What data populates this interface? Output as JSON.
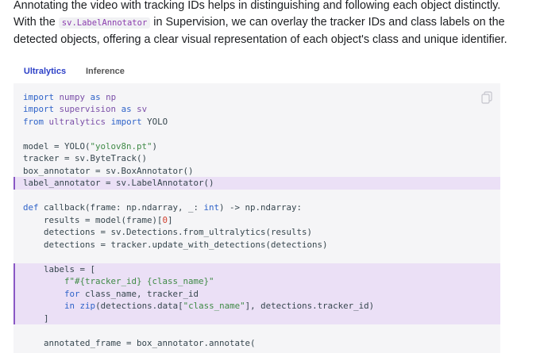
{
  "prose": {
    "line1": "Annotating the video with tracking IDs helps in distinguishing and following each object distinctly.",
    "line2_before": "With the ",
    "inline_code": "sv.LabelAnnotator",
    "line2_after": " in Supervision, we can overlay the tracker IDs and class labels on the",
    "line3": "detected objects, offering a clear visual representation of each object's class and unique identifier."
  },
  "tabs": [
    {
      "label": "Ultralytics",
      "active": true
    },
    {
      "label": "Inference",
      "active": false
    }
  ],
  "code": {
    "copy_icon": "copy-icon",
    "lines": [
      {
        "tokens": [
          [
            "kw",
            "import"
          ],
          [
            "plain",
            " "
          ],
          [
            "mod",
            "numpy"
          ],
          [
            "plain",
            " "
          ],
          [
            "kw",
            "as"
          ],
          [
            "plain",
            " "
          ],
          [
            "mod",
            "np"
          ]
        ]
      },
      {
        "tokens": [
          [
            "kw",
            "import"
          ],
          [
            "plain",
            " "
          ],
          [
            "mod",
            "supervision"
          ],
          [
            "plain",
            " "
          ],
          [
            "kw",
            "as"
          ],
          [
            "plain",
            " "
          ],
          [
            "mod",
            "sv"
          ]
        ]
      },
      {
        "tokens": [
          [
            "kw",
            "from"
          ],
          [
            "plain",
            " "
          ],
          [
            "mod",
            "ultralytics"
          ],
          [
            "plain",
            " "
          ],
          [
            "kw",
            "import"
          ],
          [
            "plain",
            " YOLO"
          ]
        ]
      },
      {
        "tokens": []
      },
      {
        "tokens": [
          [
            "plain",
            "model = YOLO("
          ],
          [
            "str",
            "\"yolov8n.pt\""
          ],
          [
            "plain",
            ")"
          ]
        ]
      },
      {
        "tokens": [
          [
            "plain",
            "tracker = sv.ByteTrack()"
          ]
        ]
      },
      {
        "tokens": [
          [
            "plain",
            "box_annotator = sv.BoxAnnotator()"
          ]
        ]
      },
      {
        "tokens": [
          [
            "plain",
            "label_annotator = sv.LabelAnnotator()"
          ]
        ],
        "highlight": true
      },
      {
        "tokens": []
      },
      {
        "tokens": [
          [
            "kw",
            "def"
          ],
          [
            "plain",
            " callback(frame: np.ndarray, _: "
          ],
          [
            "kw",
            "int"
          ],
          [
            "plain",
            ") -> np.ndarray:"
          ]
        ]
      },
      {
        "tokens": [
          [
            "plain",
            "    results = model(frame)["
          ],
          [
            "num",
            "0"
          ],
          [
            "plain",
            "]"
          ]
        ]
      },
      {
        "tokens": [
          [
            "plain",
            "    detections = sv.Detections.from_ultralytics(results)"
          ]
        ]
      },
      {
        "tokens": [
          [
            "plain",
            "    detections = tracker.update_with_detections(detections)"
          ]
        ]
      },
      {
        "tokens": []
      },
      {
        "tokens": [
          [
            "plain",
            "    labels = ["
          ]
        ],
        "highlight": true
      },
      {
        "tokens": [
          [
            "plain",
            "        "
          ],
          [
            "str",
            "f\"#{tracker_id} {class_name}\""
          ]
        ],
        "highlight": true
      },
      {
        "tokens": [
          [
            "plain",
            "        "
          ],
          [
            "kw",
            "for"
          ],
          [
            "plain",
            " class_name, tracker_id"
          ]
        ],
        "highlight": true
      },
      {
        "tokens": [
          [
            "plain",
            "        "
          ],
          [
            "kw",
            "in"
          ],
          [
            "plain",
            " "
          ],
          [
            "kw",
            "zip"
          ],
          [
            "plain",
            "(detections.data["
          ],
          [
            "str",
            "\"class_name\""
          ],
          [
            "plain",
            "], detections.tracker_id)"
          ]
        ],
        "highlight": true
      },
      {
        "tokens": [
          [
            "plain",
            "    ]"
          ]
        ],
        "highlight": true
      },
      {
        "tokens": []
      },
      {
        "tokens": [
          [
            "plain",
            "    annotated_frame = box_annotator.annotate("
          ]
        ]
      }
    ]
  }
}
